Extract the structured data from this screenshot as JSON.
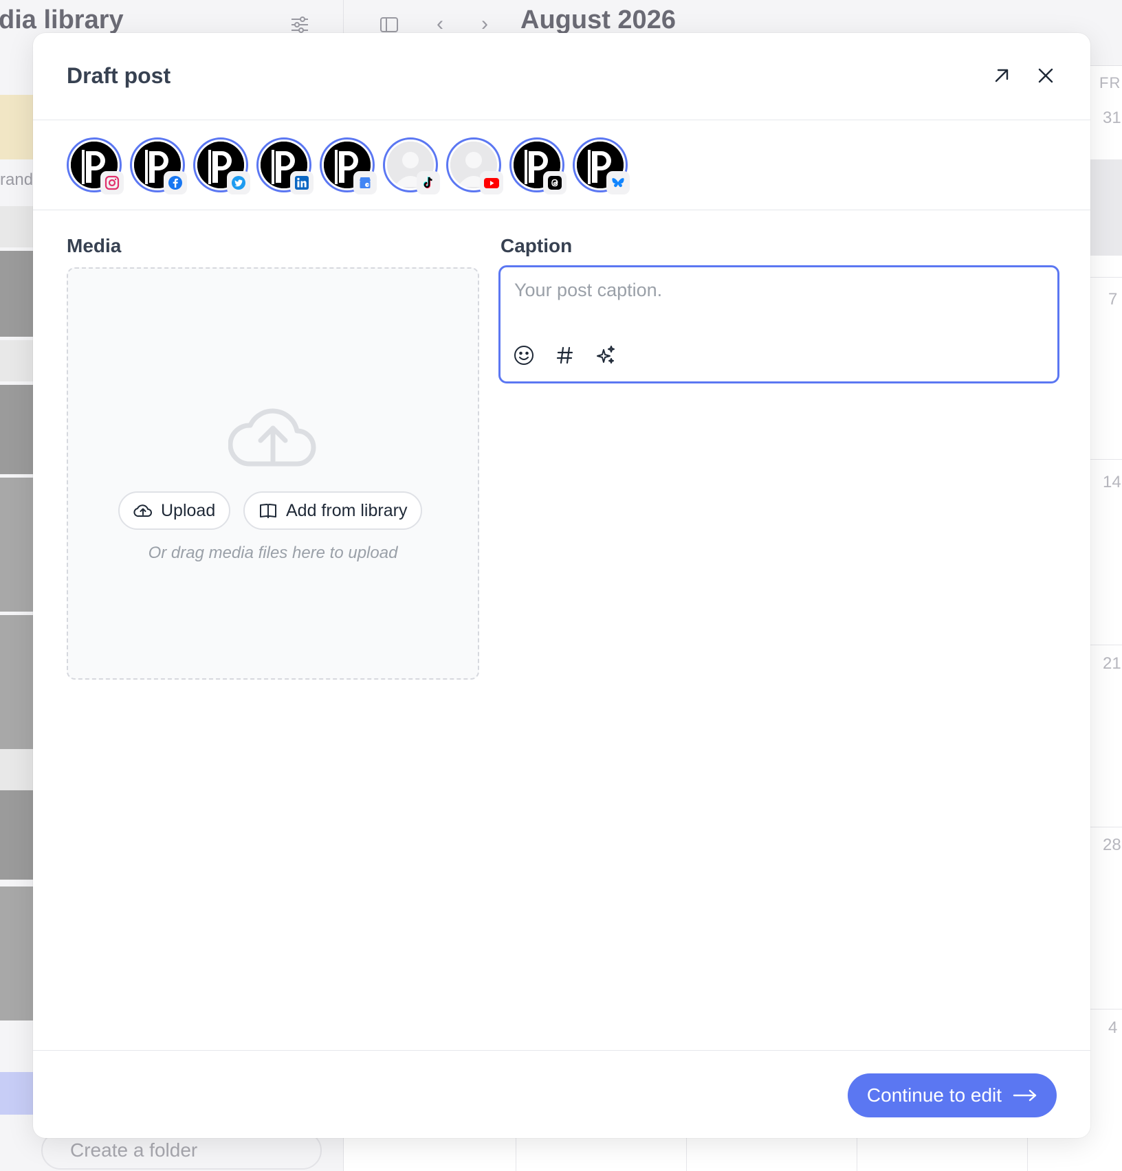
{
  "background": {
    "sidebar_title": "dia library",
    "calendar_month": "August 2026",
    "weekday": "FRI",
    "day_numbers": [
      "31",
      "7",
      "14",
      "21",
      "28",
      "4"
    ],
    "brand_text": "rand",
    "create_folder_label": "Create a folder",
    "sidebar_title_icon": "sliders-icon",
    "sidebar_toggle_icon": "sidebar-icon"
  },
  "modal": {
    "title": "Draft post",
    "expand_icon": "arrow-up-right-icon",
    "close_icon": "close-icon",
    "accounts": [
      {
        "network": "instagram",
        "avatar": "logo-p",
        "badge_icon": "instagram-icon"
      },
      {
        "network": "facebook",
        "avatar": "logo-p",
        "badge_icon": "facebook-icon"
      },
      {
        "network": "twitter",
        "avatar": "logo-p",
        "badge_icon": "twitter-icon"
      },
      {
        "network": "linkedin",
        "avatar": "logo-p",
        "badge_icon": "linkedin-icon"
      },
      {
        "network": "google-business",
        "avatar": "logo-p",
        "badge_icon": "google-business-icon"
      },
      {
        "network": "tiktok",
        "avatar": "placeholder",
        "badge_icon": "tiktok-icon"
      },
      {
        "network": "youtube",
        "avatar": "placeholder",
        "badge_icon": "youtube-icon"
      },
      {
        "network": "threads",
        "avatar": "logo-p",
        "badge_icon": "threads-icon"
      },
      {
        "network": "bluesky",
        "avatar": "logo-p",
        "badge_icon": "bluesky-icon"
      }
    ],
    "media": {
      "label": "Media",
      "upload_label": "Upload",
      "library_label": "Add from library",
      "drag_hint": "Or drag media files here to upload"
    },
    "caption": {
      "label": "Caption",
      "value": "",
      "placeholder": "Your post caption.",
      "tools": [
        "emoji-icon",
        "hashtag-icon",
        "sparkles-icon"
      ]
    },
    "footer": {
      "continue_label": "Continue to edit"
    }
  },
  "colors": {
    "accent": "#5b77f2",
    "border": "#e5e7eb",
    "text": "#374151",
    "placeholder": "#9aa0a8"
  }
}
